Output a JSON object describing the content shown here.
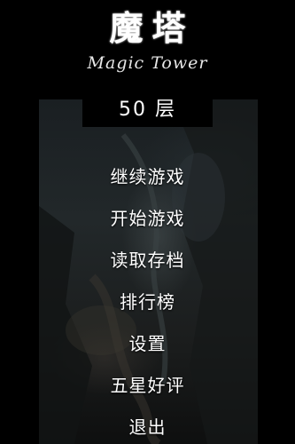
{
  "title": {
    "main": "魔塔",
    "subtitle": "Magic Tower"
  },
  "floor": {
    "label": "50 层"
  },
  "menu": {
    "items": [
      {
        "label": "继续游戏"
      },
      {
        "label": "开始游戏"
      },
      {
        "label": "读取存档"
      },
      {
        "label": "排行榜"
      },
      {
        "label": "设置"
      },
      {
        "label": "五星好评"
      },
      {
        "label": "退出"
      }
    ]
  },
  "colors": {
    "background": "#000000",
    "text": "#ffffff"
  }
}
